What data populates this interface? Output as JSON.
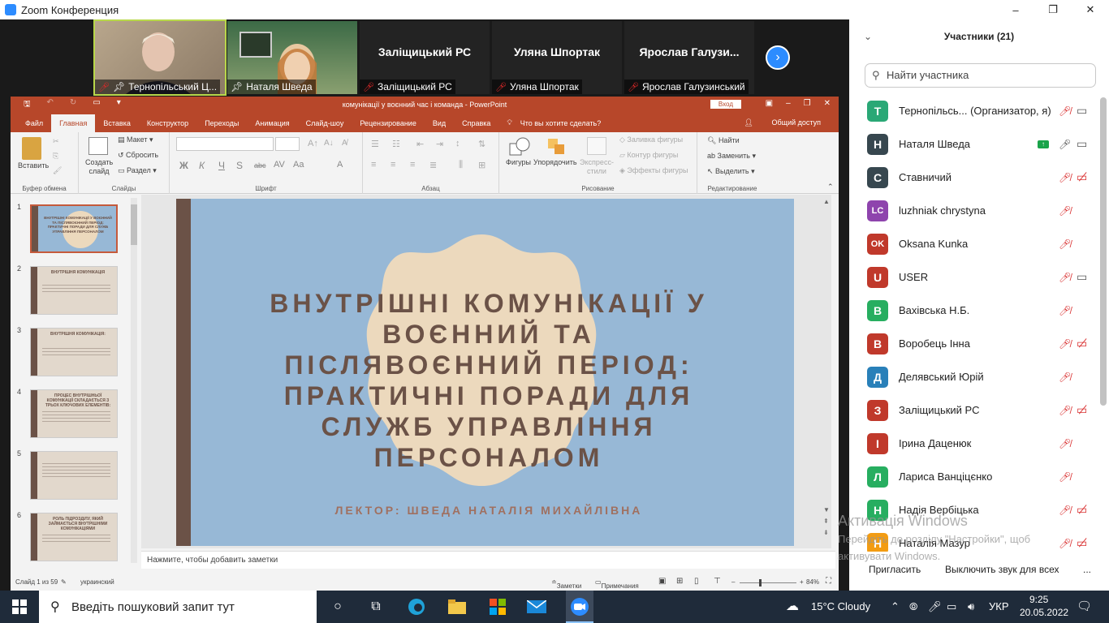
{
  "window": {
    "title": "Zoom Конференция",
    "minimize": "–",
    "restore": "❐",
    "close": "✕"
  },
  "gallery": {
    "tiles": [
      {
        "name": "Тернопільський Ц...",
        "big": ""
      },
      {
        "name": "Наталя Шведа",
        "big": ""
      },
      {
        "name": "Заліщицький РС",
        "big": "Заліщицький РС"
      },
      {
        "name": "Уляна Шпортак",
        "big": "Уляна Шпортак"
      },
      {
        "name": "Ярослав Галузинський",
        "big": "Ярослав  Галузи..."
      }
    ],
    "next": "›"
  },
  "powerpoint": {
    "title": "комунікації у воєнний час і команда  -  PowerPoint",
    "signin": "Вход",
    "tabs": [
      "Файл",
      "Главная",
      "Вставка",
      "Конструктор",
      "Переходы",
      "Анимация",
      "Слайд-шоу",
      "Рецензирование",
      "Вид",
      "Справка"
    ],
    "tell_me": "Что вы хотите сделать?",
    "share": "Общий доступ",
    "ribbon": {
      "paste": "Вставить",
      "clipboard": "Буфер обмена",
      "new_slide": "Создать слайд",
      "layout": "Макет",
      "reset": "Сбросить",
      "section": "Раздел",
      "slides": "Слайды",
      "font_group": "Шрифт",
      "font_buttons": [
        "Ж",
        "К",
        "Ч",
        "S",
        "abc",
        "AV",
        "Aa",
        "A"
      ],
      "paragraph": "Абзац",
      "shapes": "Фигуры",
      "arrange": "Упорядочить",
      "quick_styles": "Экспресс-стили",
      "shape_fill": "Заливка фигуры",
      "shape_outline": "Контур фигуры",
      "shape_effects": "Эффекты фигуры",
      "drawing": "Рисование",
      "find": "Найти",
      "replace": "Заменить",
      "select": "Выделить",
      "editing": "Редактирование"
    },
    "thumbnails": [
      {
        "num": "1",
        "title": "ВНУТРІШНІ КОМУНІКАЦІЇ У ВОЄННИЙ ТА ПІСЛЯВОЄННИЙ ПЕРІОД: ПРАКТИЧНІ ПОРАДИ ДЛЯ СЛУЖБ УПРАВЛІННЯ ПЕРСОНАЛОМ"
      },
      {
        "num": "2",
        "title": "ВНУТРІШНЯ КОМУНІКАЦІЯ"
      },
      {
        "num": "3",
        "title": "ВНУТРІШНЯ КОМУНІКАЦІЯ:"
      },
      {
        "num": "4",
        "title": "ПРОЦЕС ВНУТРІШНЬОЇ КОМУНІКАЦІЇ СКЛАДАЄТЬСЯ З ТРЬОХ КЛЮЧОВИХ ЕЛЕМЕНТІВ:"
      },
      {
        "num": "5",
        "title": ""
      },
      {
        "num": "6",
        "title": "РОЛЬ ПІДРОЗДІЛУ, ЯКИЙ ЗАЙМАЄТЬСЯ ВНУТРІШНІМИ КОМУНІКАЦІЯМИ"
      }
    ],
    "slide": {
      "title": "ВНУТРІШНІ КОМУНІКАЦІЇ У ВОЄННИЙ ТА ПІСЛЯВОЄННИЙ ПЕРІОД: ПРАКТИЧНІ ПОРАДИ ДЛЯ СЛУЖБ УПРАВЛІННЯ ПЕРСОНАЛОМ",
      "lector": "ЛЕКТОР: ШВЕДА НАТАЛІЯ МИХАЙЛІВНА"
    },
    "notes": "Нажмите, чтобы добавить заметки",
    "status": {
      "slide_of": "Слайд 1 из 59",
      "language": "украинский",
      "notes": "Заметки",
      "comments": "Примечания",
      "zoom": "84%"
    }
  },
  "participants": {
    "header": "Участники (21)",
    "search_placeholder": "Найти участника",
    "list": [
      {
        "initial": "T",
        "name": "Тернопільсь...  (Организатор, я)",
        "color": "#2aa876",
        "mic": "off",
        "cam": "on"
      },
      {
        "initial": "H",
        "name": "Наталя Шведа",
        "color": "#37474f",
        "mic": "on",
        "cam": "on",
        "share": true
      },
      {
        "initial": "C",
        "name": "Ставничий",
        "color": "#37474f",
        "mic": "off",
        "cam": "off"
      },
      {
        "initial": "LC",
        "name": "luzhniak chrystyna",
        "color": "#8e44ad",
        "mic": "off",
        "cam": ""
      },
      {
        "initial": "OK",
        "name": "Oksana Kunka",
        "color": "#c0392b",
        "mic": "off",
        "cam": ""
      },
      {
        "initial": "U",
        "name": "USER",
        "color": "#c0392b",
        "mic": "off",
        "cam": "on"
      },
      {
        "initial": "B",
        "name": "Вахівська Н.Б.",
        "color": "#27ae60",
        "mic": "off",
        "cam": ""
      },
      {
        "initial": "B",
        "name": "Воробець Інна",
        "color": "#c0392b",
        "mic": "off",
        "cam": "off"
      },
      {
        "initial": "Д",
        "name": "Делявський Юрій",
        "color": "#2980b9",
        "mic": "off",
        "cam": ""
      },
      {
        "initial": "З",
        "name": "Заліщицький РС",
        "color": "#c0392b",
        "mic": "off",
        "cam": "off"
      },
      {
        "initial": "І",
        "name": "Ірина Даценюк",
        "color": "#c0392b",
        "mic": "off",
        "cam": ""
      },
      {
        "initial": "Л",
        "name": "Лариса Ванціцєнко",
        "color": "#27ae60",
        "mic": "off",
        "cam": ""
      },
      {
        "initial": "Н",
        "name": "Надія Вербіцька",
        "color": "#27ae60",
        "mic": "off",
        "cam": "off"
      },
      {
        "initial": "Н",
        "name": "Наталія Мазур",
        "color": "#f39c12",
        "mic": "off",
        "cam": "off"
      }
    ],
    "invite": "Пригласить",
    "mute_all": "Выключить звук для всех",
    "more": "..."
  },
  "activation": {
    "line1": "Активація Windows",
    "line2": "Перейдіть до розділу \"Настройки\", щоб",
    "line3": "активувати Windows."
  },
  "taskbar": {
    "search": "Введіть пошуковий запит тут",
    "weather": "15°C  Cloudy",
    "lang": "УКР",
    "time": "9:25",
    "date": "20.05.2022"
  }
}
